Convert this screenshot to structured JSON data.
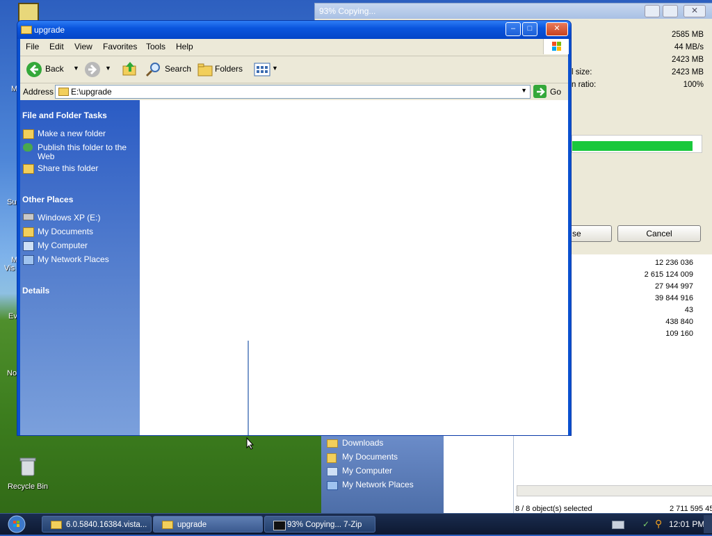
{
  "desktop": {
    "recycle_bin_label": "Recycle Bin",
    "fragments": [
      "M",
      "Su",
      "M",
      "Vis",
      "Ev",
      "No"
    ]
  },
  "bg_7zip": {
    "title": "93% Copying...",
    "rows": [
      {
        "label": "",
        "value": "2585 MB"
      },
      {
        "label": "",
        "value": "44 MB/s"
      },
      {
        "label": "",
        "value": "2423 MB"
      },
      {
        "label": "l size:",
        "value": "2423 MB"
      },
      {
        "label": "n ratio:",
        "value": "100%"
      }
    ],
    "progress_percent": 93,
    "pause_fragment": "se",
    "cancel_label": "Cancel"
  },
  "bg_explorer": {
    "numbers": [
      "12 236 036",
      "2 615 124 009",
      "27 944 997",
      "39 844 916",
      "43",
      "438 840",
      "109 160"
    ],
    "left_links": [
      "Downloads",
      "My Documents",
      "My Computer",
      "My Network Places"
    ],
    "status_left": "8 / 8 object(s) selected",
    "status_right": "2 711 595 45"
  },
  "window": {
    "title": "upgrade",
    "menu": [
      "File",
      "Edit",
      "View",
      "Favorites",
      "Tools",
      "Help"
    ],
    "toolbar": {
      "back": "Back",
      "search": "Search",
      "folders": "Folders"
    },
    "address_label": "Address",
    "address_value": "E:\\upgrade",
    "go_label": "Go",
    "file_tasks": {
      "header": "File and Folder Tasks",
      "items": [
        "Make a new folder",
        "Publish this folder to the Web",
        "Share this folder"
      ]
    },
    "other_places": {
      "header": "Other Places",
      "items": [
        "Windows XP (E:)",
        "My Documents",
        "My Computer",
        "My Network Places"
      ]
    },
    "details_header": "Details"
  },
  "taskbar": {
    "items": [
      "6.0.5840.16384.vista...",
      "upgrade",
      "93% Copying... 7-Zip"
    ],
    "clock": "12:01 PM"
  },
  "colors": {
    "accent": "#0a55dd",
    "progress": "#19c83c"
  }
}
